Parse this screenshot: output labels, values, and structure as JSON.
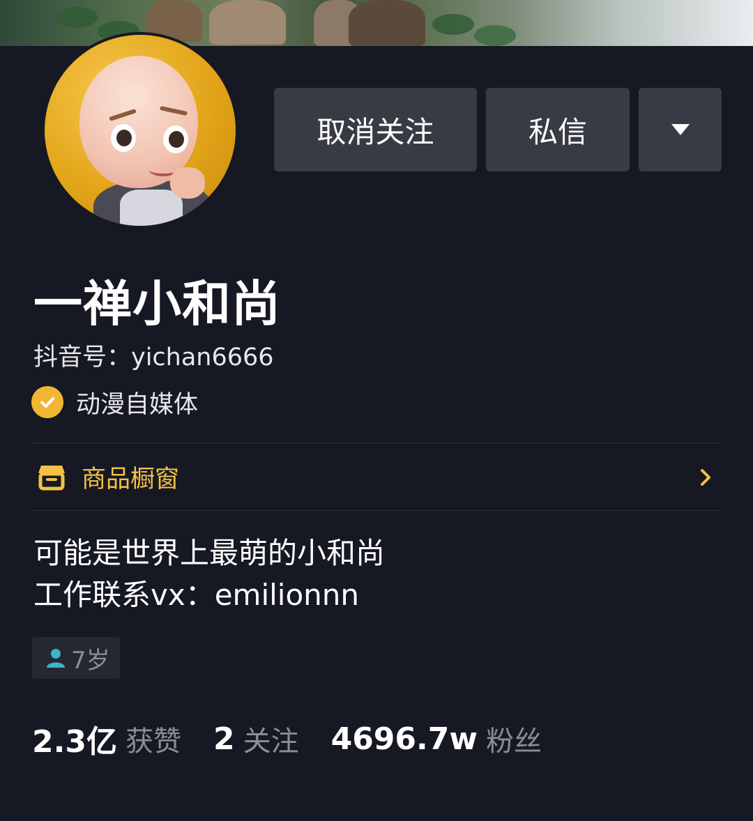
{
  "profile": {
    "name": "一禅小和尚",
    "douyin_id": "抖音号：yichan6666",
    "verification": "动漫自媒体",
    "bio": [
      "可能是世界上最萌的小和尚",
      "工作联系vx：emilionnn"
    ],
    "age_tag": "7岁"
  },
  "actions": {
    "unfollow_label": "取消关注",
    "message_label": "私信",
    "more_icon": "caret-down-icon"
  },
  "shop": {
    "label": "商品橱窗",
    "icon": "storefront-icon",
    "chevron": "chevron-right-icon"
  },
  "stats": [
    {
      "value": "2.3亿",
      "label": "获赞"
    },
    {
      "value": "2",
      "label": "关注"
    },
    {
      "value": "4696.7w",
      "label": "粉丝"
    }
  ],
  "colors": {
    "background": "#161823",
    "button": "#393b44",
    "accent_gold": "#f3c244",
    "verify_badge": "#f2b632",
    "muted_text": "#8b8d96",
    "age_icon": "#3bb6c6"
  }
}
